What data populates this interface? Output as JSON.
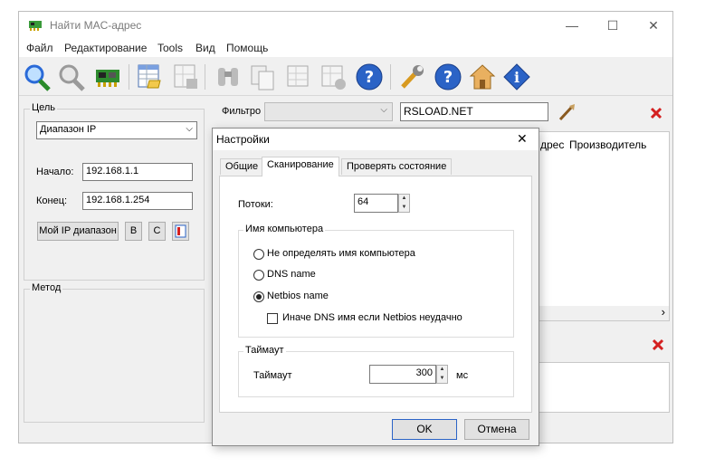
{
  "window": {
    "title": "Найти MAC-адрес",
    "minimize": "—",
    "maximize": "☐",
    "close": "✕"
  },
  "menu": [
    "Файл",
    "Редактирование",
    "Tools",
    "Вид",
    "Помощь"
  ],
  "target": {
    "group_label": "Цель",
    "range_select": "Диапазон IP",
    "start_label": "Начало:",
    "start_value": "192.168.1.1",
    "end_label": "Конец:",
    "end_value": "192.168.1.254",
    "my_range_button": "Мой IP диапазон",
    "b_button": "B",
    "c_button": "C"
  },
  "method": {
    "group_label": "Метод"
  },
  "filter": {
    "label": "Фильтро",
    "text_value": "RSLOAD.NET"
  },
  "table": {
    "col_vendor": "Производитель",
    "col_address_partial": "дрес",
    "scroll_right": "›"
  },
  "dialog": {
    "title": "Настройки",
    "close": "✕",
    "tabs": [
      "Общие",
      "Сканирование",
      "Проверять состояние"
    ],
    "threads_label": "Потоки:",
    "threads_value": "64",
    "computer_name_group": "Имя компьютера",
    "opt_none": "Не определять имя компьютера",
    "opt_dns": "DNS name",
    "opt_netbios": "Netbios name",
    "opt_fallback": "Иначе DNS имя если Netbios неудачно",
    "timeout_group": "Таймаут",
    "timeout_label": "Таймаут",
    "timeout_value": "300",
    "timeout_unit": "мс",
    "ok": "OK",
    "cancel": "Отмена"
  },
  "colors": {
    "accent_blue": "#2b63c6",
    "delete_red": "#d42020"
  }
}
